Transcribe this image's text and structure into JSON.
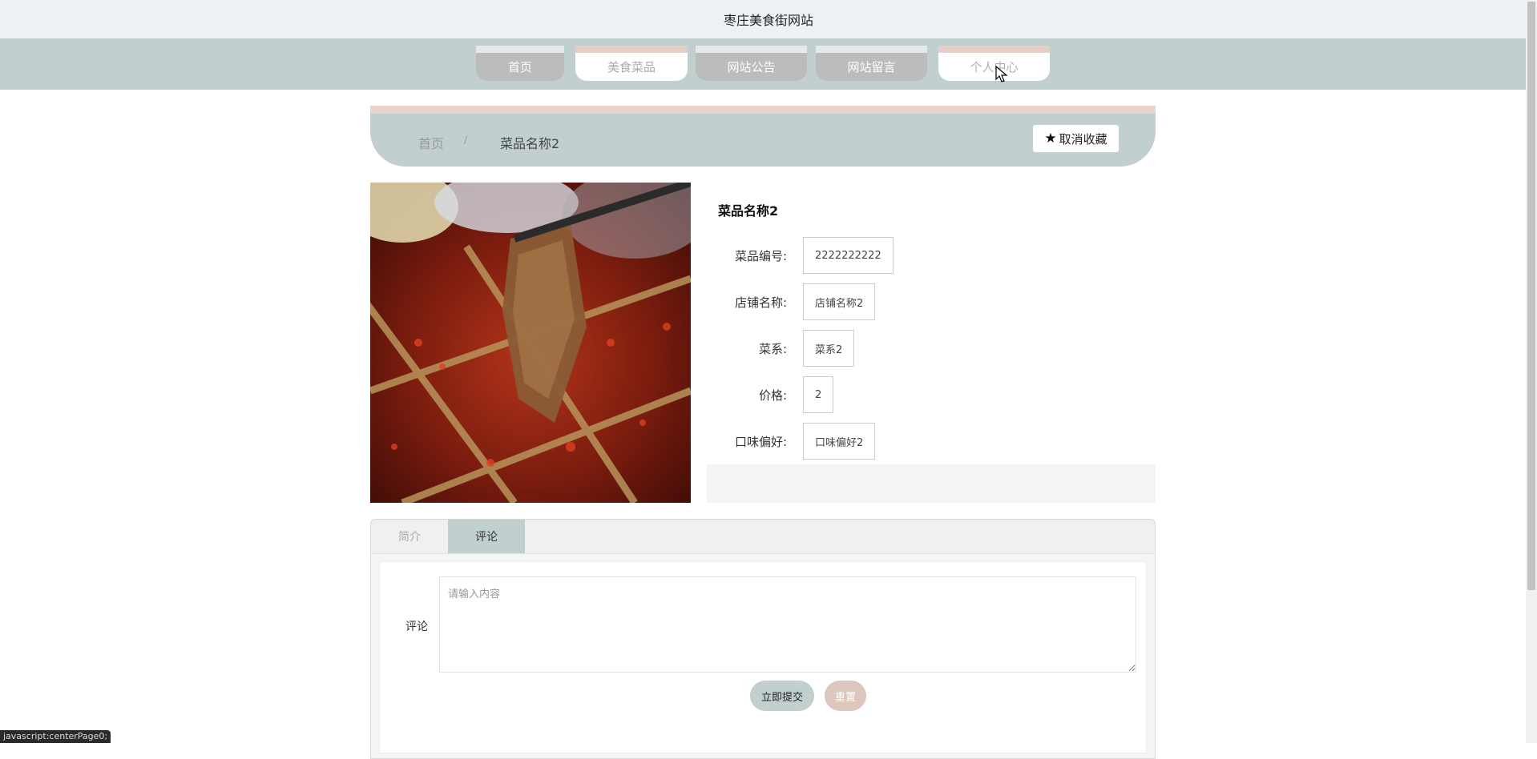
{
  "site": {
    "title": "枣庄美食街网站"
  },
  "nav": {
    "items": [
      {
        "label": "首页"
      },
      {
        "label": "美食菜品"
      },
      {
        "label": "网站公告"
      },
      {
        "label": "网站留言"
      },
      {
        "label": "个人中心"
      }
    ]
  },
  "breadcrumb": {
    "home": "首页",
    "separator": "/",
    "current": "菜品名称2"
  },
  "favorite": {
    "label": "取消收藏",
    "icon": "star-icon"
  },
  "product": {
    "name": "菜品名称2",
    "fields": [
      {
        "label": "菜品编号:",
        "value": "2222222222"
      },
      {
        "label": "店铺名称:",
        "value": "店铺名称2"
      },
      {
        "label": "菜系:",
        "value": "菜系2"
      },
      {
        "label": "价格:",
        "value": "2"
      },
      {
        "label": "口味偏好:",
        "value": "口味偏好2"
      }
    ]
  },
  "tabs": [
    {
      "label": "简介"
    },
    {
      "label": "评论"
    }
  ],
  "comment": {
    "label": "评论",
    "placeholder": "请输入内容",
    "submit_label": "立即提交",
    "reset_label": "重置"
  },
  "status": {
    "url": "javascript:centerPage0;"
  },
  "colors": {
    "accent": "#c1d0cf",
    "pink": "#e7cfc6",
    "topbar": "#edf1f4"
  }
}
